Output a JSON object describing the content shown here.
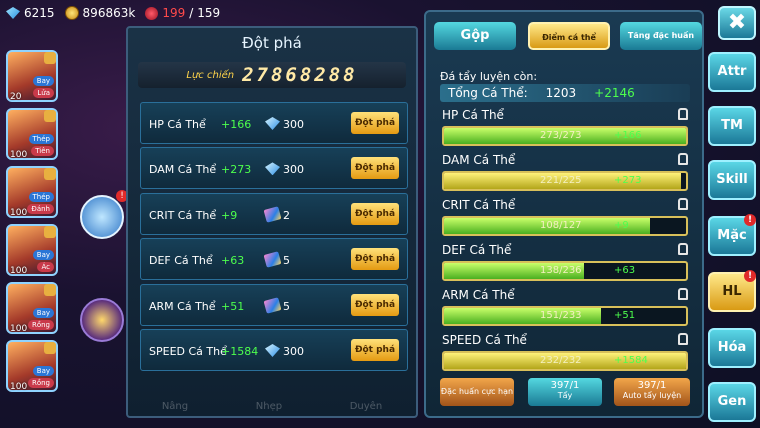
{
  "topbar": {
    "diamonds": "6215",
    "gold": "896863k",
    "energy_current": "199",
    "energy_separator": "/",
    "energy_max": "159",
    "icons": [
      "diamond-icon",
      "gold-coin-icon",
      "energy-heart-icon"
    ]
  },
  "pets": [
    {
      "level": "20",
      "type1": "Bay",
      "type2": "Lửa"
    },
    {
      "level": "100",
      "type1": "Thép",
      "type2": "Tiên"
    },
    {
      "level": "100",
      "type1": "Thép",
      "type2": "Đánh"
    },
    {
      "level": "100",
      "type1": "Bay",
      "type2": "Ác"
    },
    {
      "level": "100",
      "type1": "Bay",
      "type2": "Rồng"
    },
    {
      "level": "100",
      "type1": "Bay",
      "type2": "Rồng"
    }
  ],
  "middle": {
    "title": "Đột phá",
    "power_label": "Lực chiến",
    "power_value": "27868288",
    "break_label": "Đột phá",
    "rows": [
      {
        "name": "HP Cá Thể",
        "bonus": "+166",
        "cost_icon": "diamond",
        "cost": "300"
      },
      {
        "name": "DAM Cá Thể",
        "bonus": "+273",
        "cost_icon": "diamond",
        "cost": "300"
      },
      {
        "name": "CRIT Cá Thể",
        "bonus": "+9",
        "cost_icon": "gem",
        "cost": "2"
      },
      {
        "name": "DEF Cá Thể",
        "bonus": "+63",
        "cost_icon": "gem",
        "cost": "5"
      },
      {
        "name": "ARM Cá Thể",
        "bonus": "+51",
        "cost_icon": "gem",
        "cost": "5"
      },
      {
        "name": "SPEED Cá Thể",
        "bonus": "+1584",
        "cost_icon": "diamond",
        "cost": "300"
      }
    ],
    "footer": [
      "Nâng",
      "Nhẹp",
      "Duyên"
    ]
  },
  "right": {
    "tabs": [
      "Gộp",
      "Điểm cá thể",
      "Tăng đặc huấn"
    ],
    "remaining_label": "Đá tẩy luyện còn:",
    "total_label": "Tổng Cá Thể:",
    "total_value": "1203",
    "total_bonus": "+2146",
    "stats": [
      {
        "name": "HP Cá Thể",
        "value": "273/273",
        "bonus": "+166",
        "fraction": 1.0,
        "fill": "g"
      },
      {
        "name": "DAM Cá Thể",
        "value": "221/225",
        "bonus": "+273",
        "fraction": 0.98,
        "fill": "y"
      },
      {
        "name": "CRIT Cá Thể",
        "value": "108/127",
        "bonus": "+9",
        "fraction": 0.85,
        "fill": "g"
      },
      {
        "name": "DEF Cá Thể",
        "value": "138/236",
        "bonus": "+63",
        "fraction": 0.58,
        "fill": "g"
      },
      {
        "name": "ARM Cá Thể",
        "value": "151/233",
        "bonus": "+51",
        "fraction": 0.65,
        "fill": "g"
      },
      {
        "name": "SPEED Cá Thể",
        "value": "232/232",
        "bonus": "+1584",
        "fraction": 1.0,
        "fill": "y"
      }
    ],
    "buttons": {
      "special": "Đặc huấn cực hạn",
      "wash_count": "397/1",
      "wash": "Tẩy",
      "auto_count": "397/1",
      "auto": "Auto tẩy luyện"
    }
  },
  "side_nav": [
    {
      "label": "Attr",
      "active": false,
      "note": ""
    },
    {
      "label": "TM",
      "active": false,
      "note": ""
    },
    {
      "label": "Skill",
      "active": false,
      "note": ""
    },
    {
      "label": "Mặc",
      "active": false,
      "note": "!"
    },
    {
      "label": "HL",
      "active": true,
      "note": "!"
    },
    {
      "label": "Hóa",
      "active": false,
      "note": ""
    },
    {
      "label": "Gen",
      "active": false,
      "note": ""
    }
  ],
  "close_label": "✖"
}
